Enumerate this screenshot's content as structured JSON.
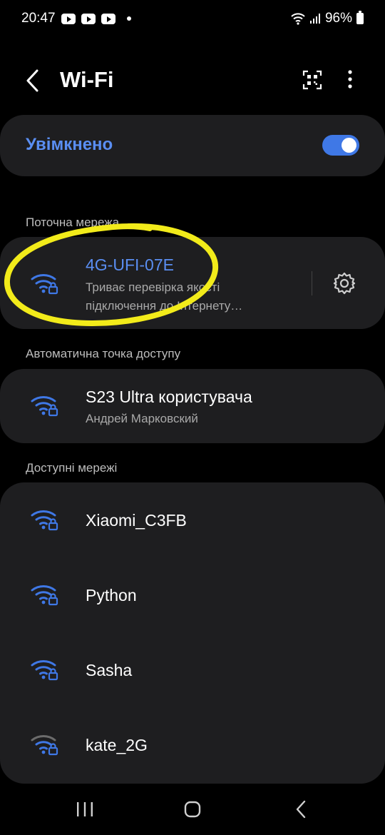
{
  "status_bar": {
    "time": "20:47",
    "battery": "96%",
    "notification_icons": [
      "youtube-icon",
      "youtube-icon",
      "youtube-icon"
    ]
  },
  "app_bar": {
    "title": "Wi-Fi"
  },
  "toggle": {
    "label": "Увімкнено",
    "on": true
  },
  "current_network": {
    "section_label": "Поточна мережа",
    "name": "4G-UFI-07E",
    "status_line1": "Триває перевірка якості",
    "status_line2": "підключення до Інтернету…"
  },
  "hotspot": {
    "section_label": "Автоматична точка доступу",
    "name": "S23 Ultra користувача",
    "owner": "Андрей Марковский"
  },
  "available": {
    "section_label": "Доступні мережі",
    "networks": [
      {
        "name": "Xiaomi_C3FB",
        "signal": "strong"
      },
      {
        "name": "Python",
        "signal": "strong"
      },
      {
        "name": "Sasha",
        "signal": "strong"
      },
      {
        "name": "kate_2G",
        "signal": "weak"
      }
    ]
  },
  "colors": {
    "accent": "#5a8ef2",
    "card": "#1e1e20",
    "highlight_circle": "#f2eb1a"
  }
}
